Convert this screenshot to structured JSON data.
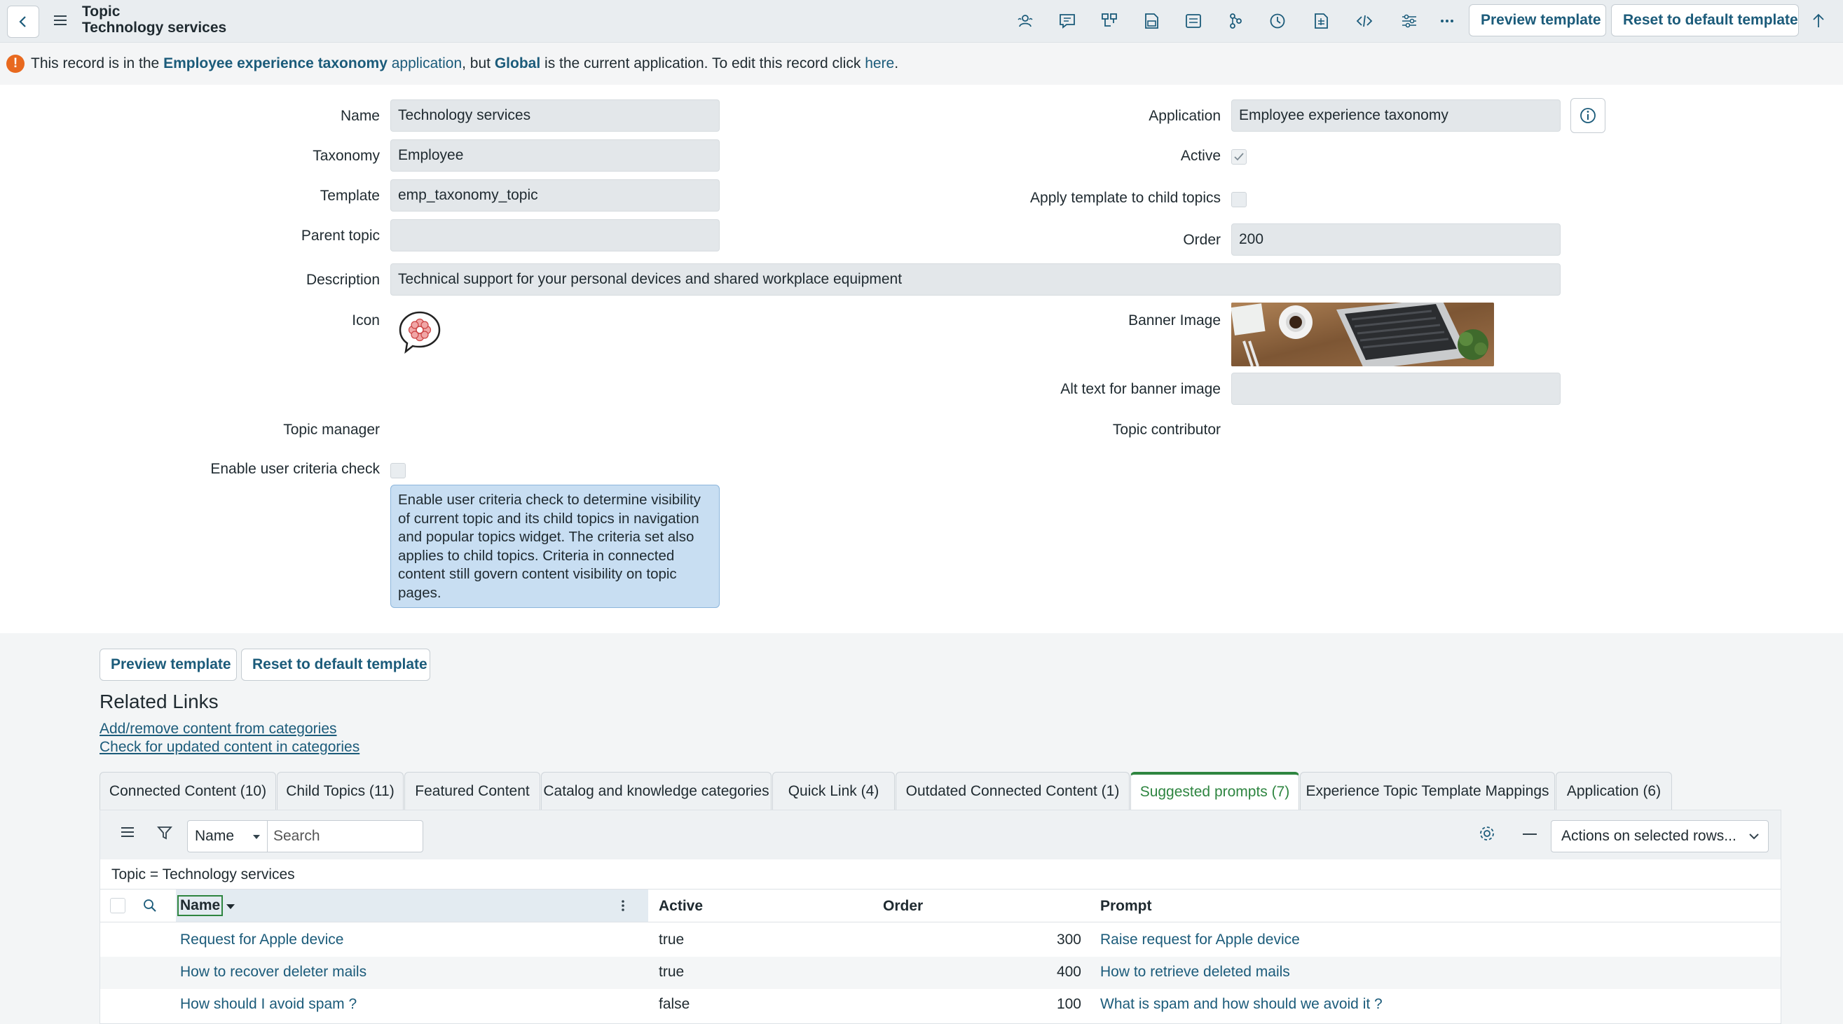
{
  "header": {
    "record_type": "Topic",
    "record_name": "Technology services",
    "preview_label": "Preview template",
    "reset_label": "Reset to default template"
  },
  "banner": {
    "t1": "This record is in the ",
    "app_name": "Employee experience taxonomy",
    "app_word": " application",
    "t2": ", but ",
    "current_app": "Global",
    "t3": " is the current application. To edit this record click ",
    "here": "here",
    "t4": "."
  },
  "form": {
    "name_label": "Name",
    "name_value": "Technology services",
    "taxonomy_label": "Taxonomy",
    "taxonomy_value": "Employee",
    "template_label": "Template",
    "template_value": "emp_taxonomy_topic",
    "parent_label": "Parent topic",
    "parent_value": "",
    "description_label": "Description",
    "description_value": "Technical support for your personal devices and shared workplace equipment",
    "icon_label": "Icon",
    "topic_manager_label": "Topic manager",
    "user_criteria_label": "Enable user criteria check",
    "user_criteria_checked": false,
    "hint": "Enable user criteria check to determine visibility of current topic and its child topics in navigation and popular topics widget. The criteria set also applies to child topics. Criteria in connected content still govern content visibility on topic pages.",
    "application_label": "Application",
    "application_value": "Employee experience taxonomy",
    "active_label": "Active",
    "active_checked": true,
    "apply_label": "Apply template to child topics",
    "apply_checked": false,
    "order_label": "Order",
    "order_value": "200",
    "banner_image_label": "Banner Image",
    "alt_text_label": "Alt text for banner image",
    "alt_text_value": "",
    "topic_contributor_label": "Topic contributor"
  },
  "lower": {
    "preview_label": "Preview template",
    "reset_label": "Reset to default template",
    "related_title": "Related Links",
    "links": [
      "Add/remove content from categories",
      "Check for updated content in categories"
    ]
  },
  "tabs": [
    {
      "label": "Connected Content (10)",
      "active": false
    },
    {
      "label": "Child Topics (11)",
      "active": false
    },
    {
      "label": "Featured Content",
      "active": false
    },
    {
      "label": "Catalog and knowledge categories",
      "active": false
    },
    {
      "label": "Quick Link (4)",
      "active": false
    },
    {
      "label": "Outdated Connected Content (1)",
      "active": false
    },
    {
      "label": "Suggested prompts (7)",
      "active": true
    },
    {
      "label": "Experience Topic Template Mappings",
      "active": false
    },
    {
      "label": "Application (6)",
      "active": false
    }
  ],
  "list": {
    "filter_field": "Name",
    "search_placeholder": "Search",
    "actions_label": "Actions on selected rows...",
    "breadcrumb": "Topic = Technology services",
    "columns": [
      "Name",
      "Active",
      "Order",
      "Prompt"
    ],
    "rows": [
      {
        "name": "Request for Apple device",
        "active": "true",
        "order": "300",
        "prompt": "Raise request for Apple device"
      },
      {
        "name": "How to recover deleter mails",
        "active": "true",
        "order": "400",
        "prompt": "How to retrieve deleted mails"
      },
      {
        "name": "How should I avoid spam ?",
        "active": "false",
        "order": "100",
        "prompt": "What is spam and how should we avoid it ?"
      }
    ]
  },
  "colors": {
    "link": "#1b5b7a",
    "active_tab": "#2e8540",
    "warning": "#e8691f",
    "hint_bg": "#c8def2"
  },
  "icons": [
    "chevron-left-icon",
    "hamburger-icon",
    "users-icon",
    "chat-icon",
    "flow-icon",
    "attachment-icon",
    "list-icon",
    "tree-icon",
    "history-icon",
    "document-icon",
    "code-icon",
    "sliders-icon",
    "more-icon",
    "scroll-up-icon",
    "info-icon",
    "gear-icon",
    "filter-icon",
    "search-icon",
    "flower-icon"
  ]
}
